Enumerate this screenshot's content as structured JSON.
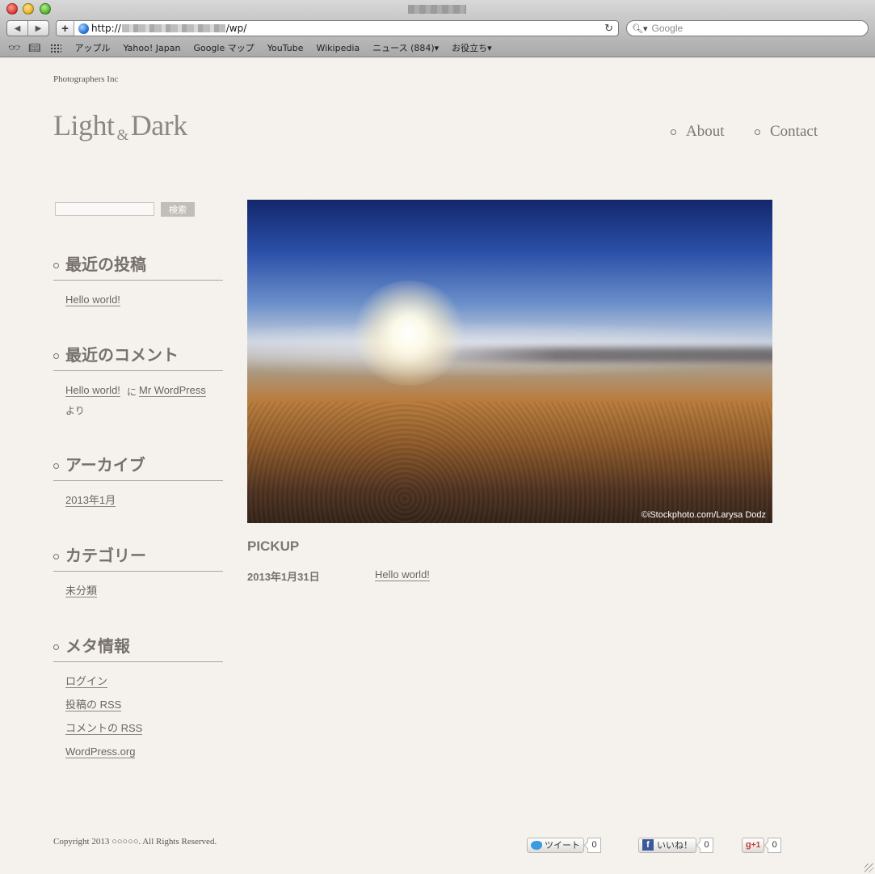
{
  "browser": {
    "url_prefix": "http://",
    "url_suffix": "/wp/",
    "search_placeholder": "Google",
    "bookmarks": [
      "アップル",
      "Yahoo! Japan",
      "Google マップ",
      "YouTube",
      "Wikipedia",
      "ニュース (884)▾",
      "お役立ち▾"
    ]
  },
  "site": {
    "description": "Photographers Inc",
    "logo_light": "Light",
    "logo_amp": "&",
    "logo_dark": "Dark",
    "nav": [
      "About",
      "Contact"
    ]
  },
  "sidebar": {
    "search_button": "検索",
    "recent_posts": {
      "title": "最近の投稿",
      "items": [
        "Hello world!"
      ]
    },
    "recent_comments": {
      "title": "最近のコメント",
      "post": "Hello world!",
      "ni": "に",
      "author": "Mr WordPress",
      "yori": "より"
    },
    "archives": {
      "title": "アーカイブ",
      "items": [
        "2013年1月"
      ]
    },
    "categories": {
      "title": "カテゴリー",
      "items": [
        "未分類"
      ]
    },
    "meta": {
      "title": "メタ情報",
      "items": [
        "ログイン",
        "投稿の RSS",
        "コメントの RSS",
        "WordPress.org"
      ]
    }
  },
  "main": {
    "hero_credit": "©iStockphoto.com/Larysa Dodz",
    "pickup_label": "PICKUP",
    "pickup_date": "2013年1月31日",
    "pickup_title": "Hello world!"
  },
  "footer": {
    "copyright": "Copyright 2013 ○○○○○. All Rights Reserved.",
    "tweet_label": "ツイート",
    "tweet_count": "0",
    "like_label": "いいね！",
    "like_count": "0",
    "plusone_label": "+1",
    "plusone_count": "0"
  }
}
